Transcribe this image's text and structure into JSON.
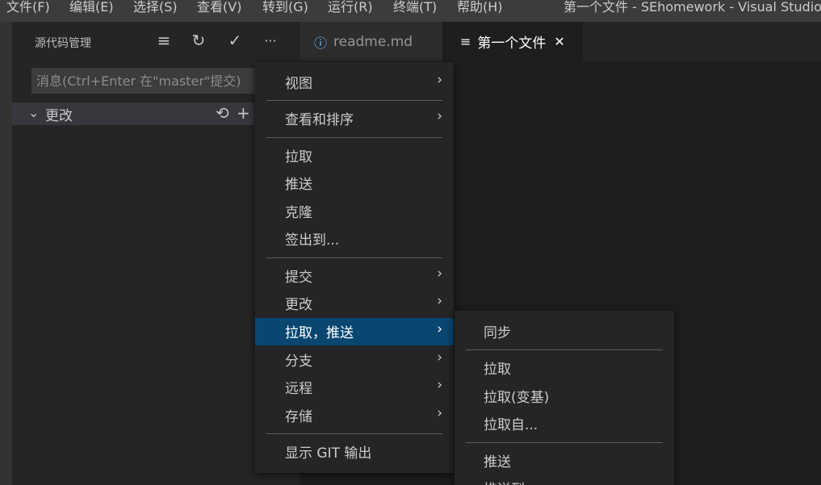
{
  "menubar": {
    "items": [
      "文件(F)",
      "编辑(E)",
      "选择(S)",
      "查看(V)",
      "转到(G)",
      "运行(R)",
      "终端(T)",
      "帮助(H)"
    ],
    "window_title": "第一个文件 - SEhomework - Visual Studio Code"
  },
  "sidebar": {
    "title": "源代码管理",
    "actions": {
      "view_as_tree": "≡",
      "refresh": "↻",
      "commit": "✓",
      "more": "···"
    },
    "message_placeholder": "消息(Ctrl+Enter 在\"master\"提交)",
    "changes": {
      "label": "更改",
      "discard_icon": "⟲",
      "stage_icon": "+"
    }
  },
  "tabs": [
    {
      "label": "readme.md",
      "icon": "ⓘ"
    },
    {
      "label": "第一个文件",
      "icon": "≡",
      "close": "✕"
    }
  ],
  "context_menu": {
    "groups": [
      [
        {
          "label": "视图",
          "submenu": true
        }
      ],
      [
        {
          "label": "查看和排序",
          "submenu": true
        }
      ],
      [
        {
          "label": "拉取"
        },
        {
          "label": "推送"
        },
        {
          "label": "克隆"
        },
        {
          "label": "签出到..."
        }
      ],
      [
        {
          "label": "提交",
          "submenu": true
        },
        {
          "label": "更改",
          "submenu": true
        },
        {
          "label": "拉取，推送",
          "submenu": true,
          "selected": true
        },
        {
          "label": "分支",
          "submenu": true
        },
        {
          "label": "远程",
          "submenu": true
        },
        {
          "label": "存储",
          "submenu": true
        }
      ],
      [
        {
          "label": "显示 GIT 输出"
        }
      ]
    ],
    "arrow": "›"
  },
  "submenu": {
    "items": [
      "同步",
      "拉取",
      "拉取(变基)",
      "拉取自...",
      "推送",
      "推送到..."
    ]
  },
  "colors": {
    "selection": "#094771",
    "accent_info": "#75beff",
    "menu_bg": "#252526"
  }
}
